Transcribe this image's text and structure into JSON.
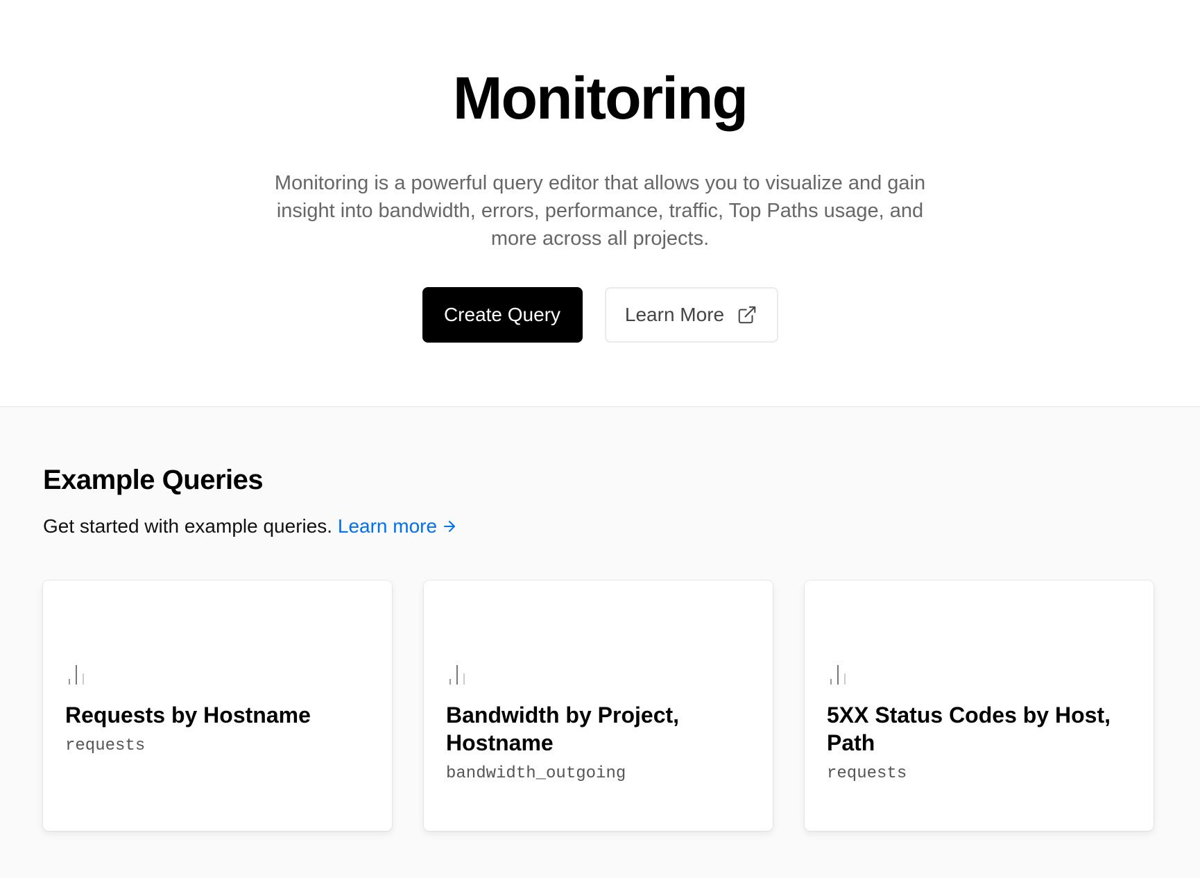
{
  "hero": {
    "title": "Monitoring",
    "description": "Monitoring is a powerful query editor that allows you to visualize and gain insight into bandwidth, errors, performance, traffic, Top Paths usage, and more across all projects.",
    "create_label": "Create Query",
    "learn_label": "Learn More"
  },
  "examples": {
    "title": "Example Queries",
    "subtitle": "Get started with example queries.",
    "link_label": "Learn more",
    "cards": [
      {
        "title": "Requests by Hostname",
        "metric": "requests"
      },
      {
        "title": "Bandwidth by Project, Hostname",
        "metric": "bandwidth_outgoing"
      },
      {
        "title": "5XX Status Codes by Host, Path",
        "metric": "requests"
      }
    ]
  },
  "colors": {
    "accent": "#0070f3",
    "primary_button": "#000000",
    "section_bg": "#fafafa"
  },
  "icons": {
    "external": "external-link-icon",
    "arrow": "arrow-right-icon",
    "card": "bar-chart-icon"
  }
}
